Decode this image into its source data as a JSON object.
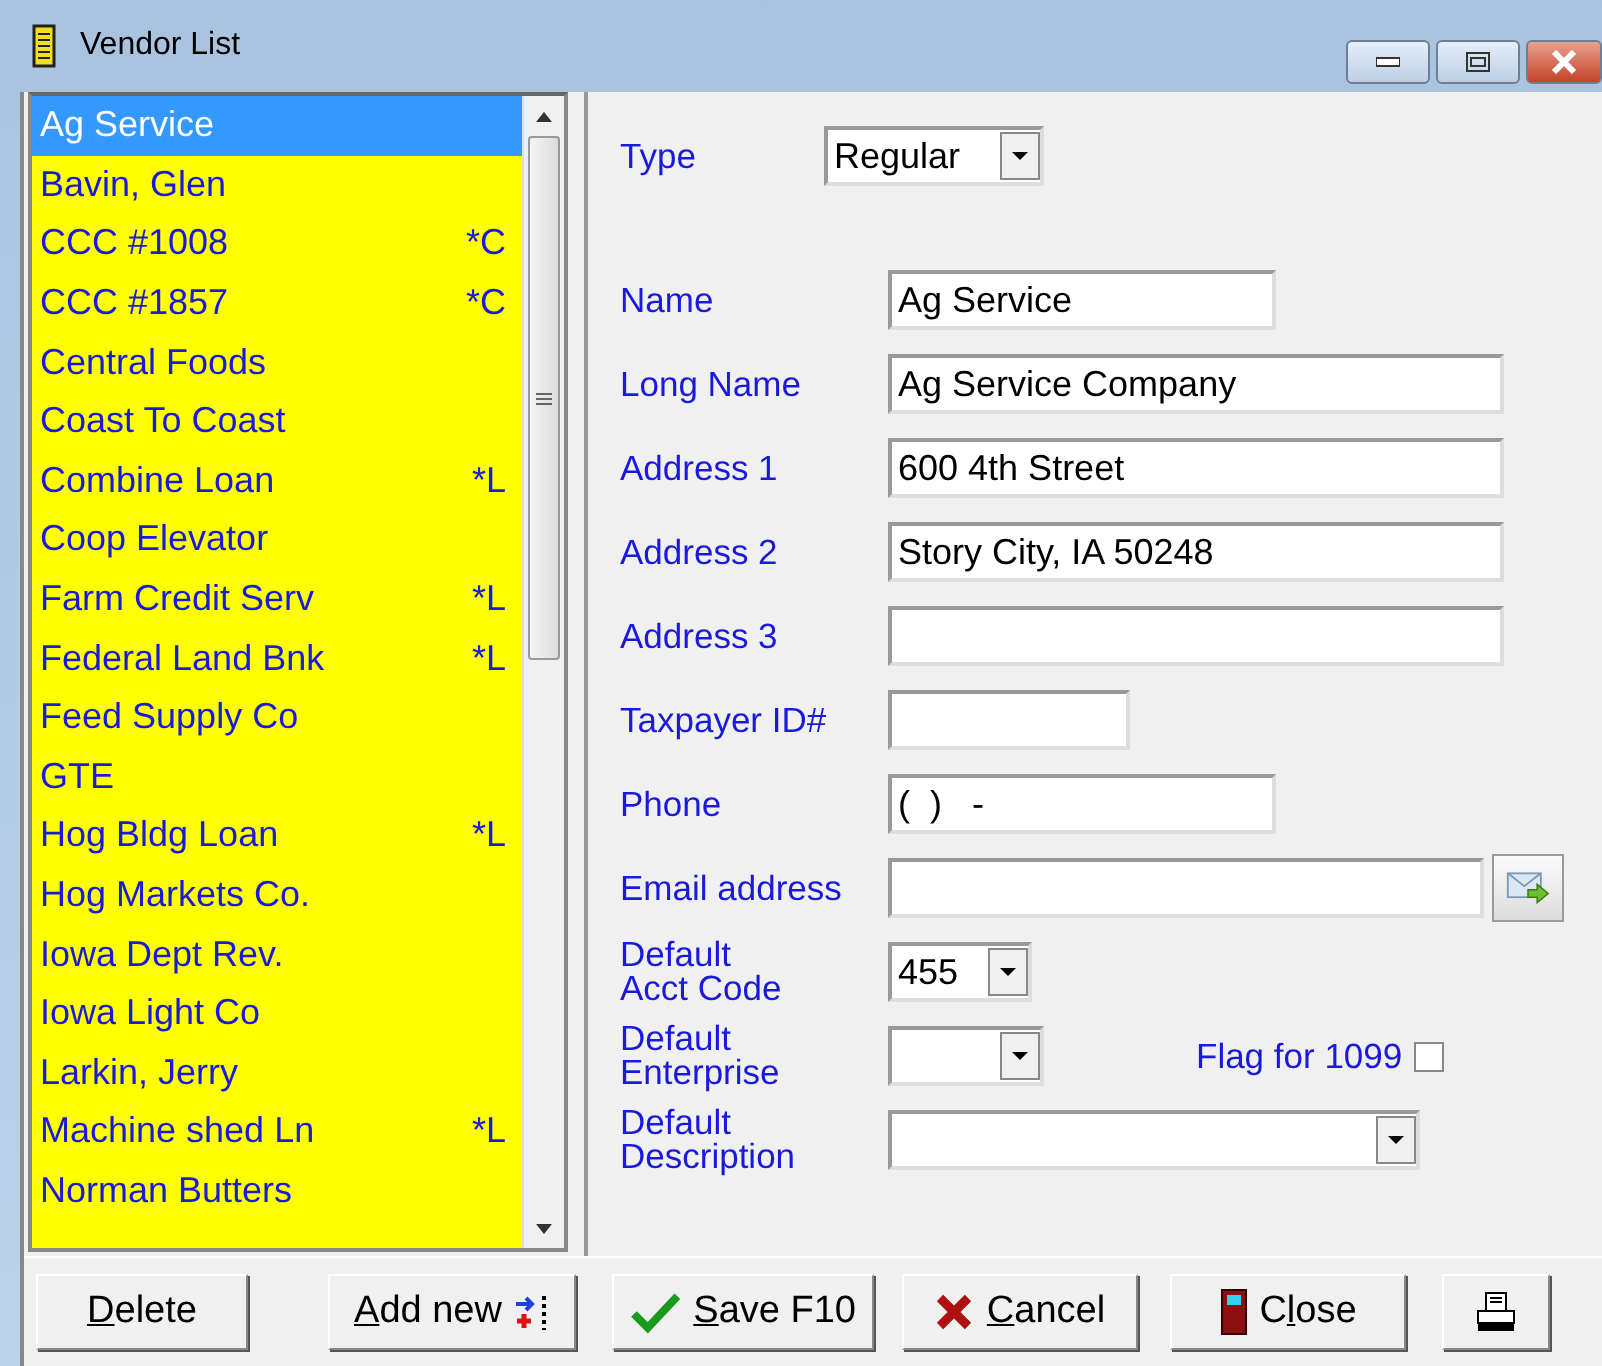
{
  "window": {
    "title": "Vendor List"
  },
  "vendors": [
    {
      "name": "Ag Service",
      "selected": true
    },
    {
      "name": "Bavin, Glen",
      "selected": false
    },
    {
      "name": "CCC #1008",
      "code": "*C",
      "selected": false
    },
    {
      "name": "CCC #1857",
      "code": "*C",
      "selected": false
    },
    {
      "name": "Central Foods",
      "selected": false
    },
    {
      "name": "Coast To Coast",
      "selected": false
    },
    {
      "name": "Combine Loan",
      "code": "*L",
      "selected": false
    },
    {
      "name": "Coop Elevator",
      "selected": false
    },
    {
      "name": "Farm Credit Serv",
      "code": "*L",
      "selected": false
    },
    {
      "name": "Federal Land Bnk",
      "code": "*L",
      "selected": false
    },
    {
      "name": "Feed Supply Co",
      "selected": false
    },
    {
      "name": "GTE",
      "selected": false
    },
    {
      "name": "Hog Bldg Loan",
      "code": "*L",
      "selected": false
    },
    {
      "name": "Hog Markets Co.",
      "selected": false
    },
    {
      "name": "Iowa Dept Rev.",
      "selected": false
    },
    {
      "name": "Iowa Light Co",
      "selected": false
    },
    {
      "name": "Larkin, Jerry",
      "selected": false
    },
    {
      "name": "Machine shed Ln",
      "code": "*L",
      "selected": false
    },
    {
      "name": "Norman Butters",
      "selected": false
    }
  ],
  "fields": [
    {
      "kind": "select",
      "label": "Type",
      "value": "Regular"
    },
    {
      "kind": "short",
      "label": "Name",
      "value": "Ag Service"
    },
    {
      "kind": "long",
      "label": "Long Name",
      "value": "Ag Service Company"
    },
    {
      "kind": "long",
      "label": "Address 1",
      "value": "600 4th Street"
    },
    {
      "kind": "long",
      "label": "Address 2",
      "value": "Story City, IA 50248"
    },
    {
      "kind": "long",
      "label": "Address 3"
    },
    {
      "kind": "tiny",
      "label": "Taxpayer ID#"
    },
    {
      "kind": "short",
      "label": "Phone",
      "value": "(  )   -"
    },
    {
      "kind": "email",
      "label": "Email address"
    },
    {
      "kind": "combo",
      "label": "Default\nAcct Code",
      "value": "455"
    },
    {
      "kind": "combo",
      "label": "Default\nEnterprise",
      "flag": {
        "label": "Flag for 1099",
        "checked": false
      }
    },
    {
      "kind": "wide",
      "label": "Default\nDescription"
    }
  ],
  "buttons": [
    {
      "kind": "delete",
      "key": "D",
      "after": "elete"
    },
    {
      "kind": "add",
      "key": "A",
      "after": "dd new"
    },
    {
      "kind": "save",
      "key": "S",
      "after": "ave F10"
    },
    {
      "kind": "cancel",
      "key": "C",
      "after": "ancel"
    },
    {
      "kind": "close",
      "before": "C",
      "key": "l",
      "after": "ose"
    },
    {
      "kind": "print"
    }
  ]
}
